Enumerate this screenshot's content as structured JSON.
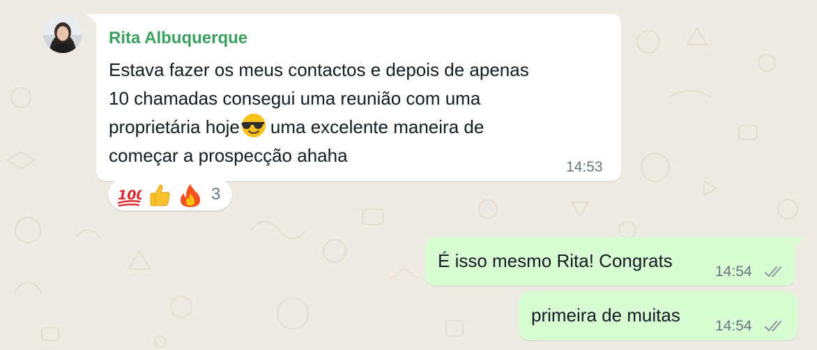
{
  "incoming": {
    "sender": "Rita Albuquerque",
    "lines": [
      "Estava fazer os meus contactos e depois de apenas",
      "10 chamadas consegui uma reunião com uma",
      "proprietária hoje",
      "uma excelente maneira de",
      "começar a prospecção ahaha"
    ],
    "inline_emoji": "smiling-face-with-sunglasses",
    "time": "14:53",
    "reactions": {
      "emojis": [
        "hundred-points",
        "thumbs-up",
        "fire"
      ],
      "count": "3"
    }
  },
  "outgoing": [
    {
      "text": "É isso mesmo Rita! Congrats",
      "time": "14:54",
      "status": "read"
    },
    {
      "text": "primeira de muitas",
      "time": "14:54",
      "status": "read"
    }
  ],
  "colors": {
    "chat_background": "#efeae2",
    "incoming_bubble": "#ffffff",
    "outgoing_bubble": "#d9fdd3",
    "sender_name": "#3a9f5f",
    "timestamp": "#667781"
  }
}
